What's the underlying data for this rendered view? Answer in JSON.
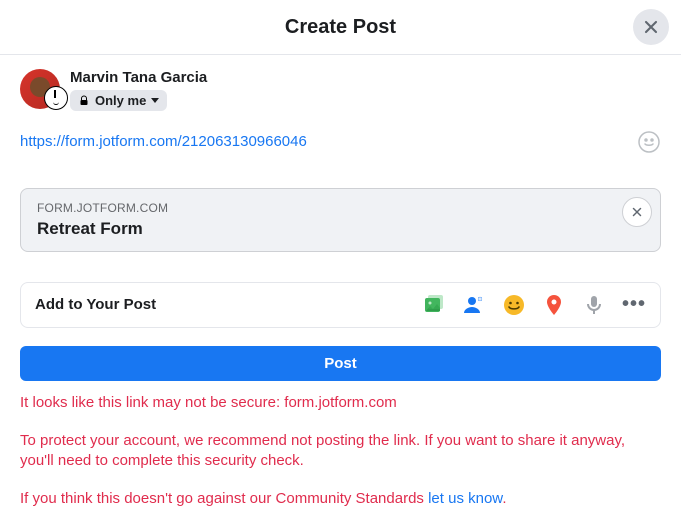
{
  "header": {
    "title": "Create Post"
  },
  "user": {
    "name": "Marvin Tana Garcia",
    "audience_label": "Only me"
  },
  "composer": {
    "link_text": "https://form.jotform.com/212063130966046"
  },
  "preview": {
    "host": "FORM.JOTFORM.COM",
    "title": "Retreat Form"
  },
  "add_section": {
    "label": "Add to Your Post"
  },
  "post_button": {
    "label": "Post"
  },
  "warnings": {
    "w1": "It looks like this link may not be secure: form.jotform.com",
    "w2": "To protect your account, we recommend not posting the link. If you want to share it anyway, you'll need to complete this security check.",
    "w3_prefix": "If you think this doesn't go against our Community Standards ",
    "w3_link": "let us know",
    "w3_suffix": "."
  }
}
